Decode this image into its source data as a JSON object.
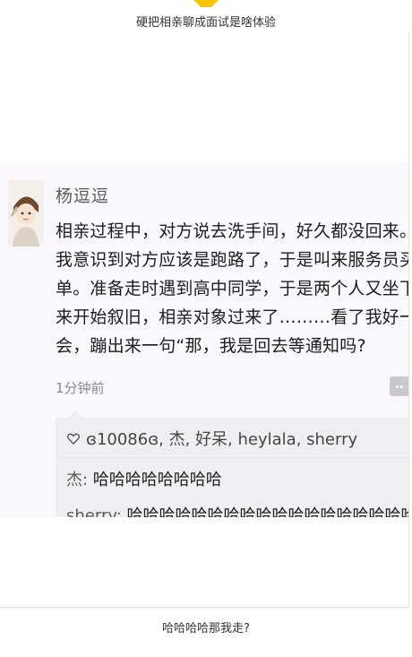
{
  "captions": {
    "top": "硬把相亲聊成面试是啥体验",
    "bottom": "哈哈哈哈那我走?"
  },
  "post": {
    "username": "杨逗逗",
    "body_lines": [
      "相亲过程中，对方说去洗手间，好久都没回来。",
      "我意识到对方应该是跑路了，于是叫来服务员买",
      "单。准备走时遇到高中同学，于是两个人又坐下",
      "来开始叙旧，相亲对象过来了………看了我好一",
      "会，蹦出来一句“那，我是回去等通知吗?"
    ],
    "time": "1分钟前",
    "likes": "ɞ10086ɞ, 杰, 好呆, heylala, sherry",
    "comments": [
      {
        "author": "杰",
        "text": "哈哈哈哈哈哈哈哈"
      },
      {
        "author": "sherry",
        "text": "哈哈哈哈哈哈哈哈哈哈哈哈哈哈哈哈哈哈"
      }
    ]
  },
  "colors": {
    "accent_marker": "#f7c600",
    "screenshot_bg": "#fbf8fd",
    "comment_bg": "#f0eef2"
  },
  "icons": {
    "like": "heart-outline-icon",
    "more": "more-dots-icon"
  }
}
